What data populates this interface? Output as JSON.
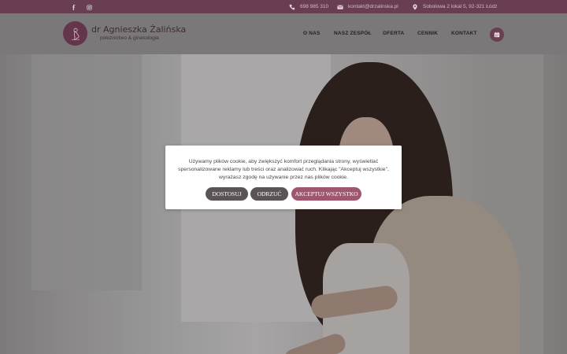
{
  "topbar": {
    "social": [
      {
        "icon": "facebook-icon"
      },
      {
        "icon": "instagram-icon"
      }
    ],
    "phone": "698 985 310",
    "email": "kontakt@drzalinska.pl",
    "address": "Sobolowa 2 lokal 5, 92-321 Łódź"
  },
  "header": {
    "logo_name": "dr Agnieszka Żalińska",
    "logo_subtitle": "położnictwo & ginekologia",
    "nav": [
      {
        "label": "O NAS"
      },
      {
        "label": "NASZ ZESPÓŁ"
      },
      {
        "label": "OFERTA"
      },
      {
        "label": "CENNIK"
      },
      {
        "label": "KONTAKT"
      }
    ],
    "calendar_icon": "calendar-icon"
  },
  "cookie": {
    "text": "Używamy plików cookie, aby zwiększyć komfort przeglądania strony, wyświetlać spersonalizowane reklamy lub treści oraz analizować ruch. Klikając \"Akceptuj wszystkie\", wyrażasz zgodę na używanie przez nas plików cookie.",
    "customize_label": "DOSTOSUJ",
    "reject_label": "ODRZUĆ",
    "accept_label": "AKCEPTUJ WSZYSTKO"
  },
  "colors": {
    "brand": "#693f52",
    "accept": "#a0566f",
    "neutral_button": "#5b5457"
  }
}
